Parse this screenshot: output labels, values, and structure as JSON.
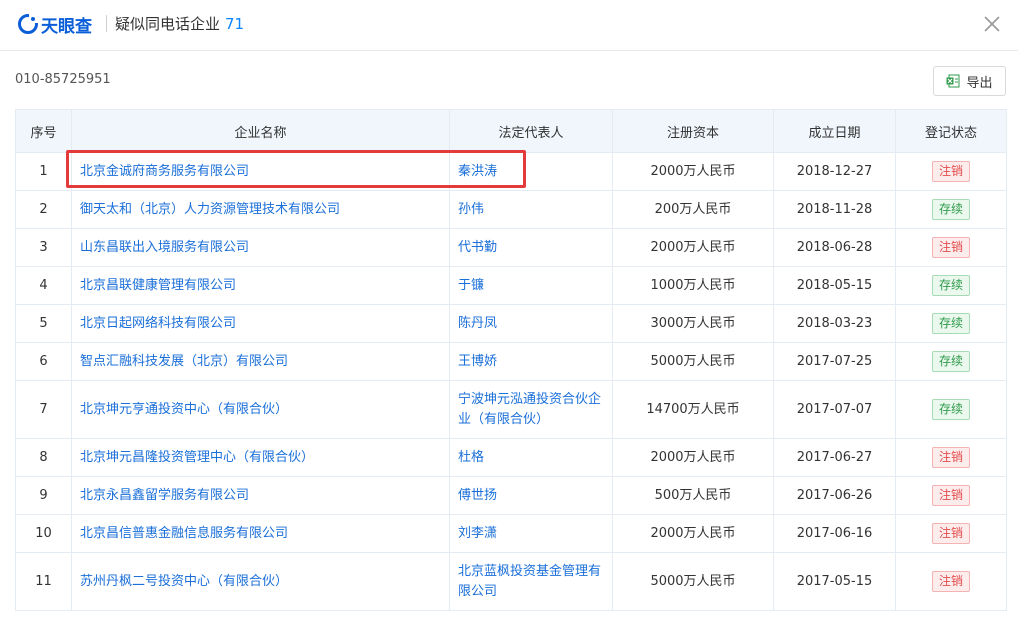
{
  "header": {
    "logo_text": "天眼查",
    "title": "疑似同电话企业",
    "count": "71"
  },
  "phone": "010-85725951",
  "export_label": "导出",
  "colors": {
    "link": "#1a6fd9",
    "accent": "#0a84ff",
    "cancel": "#e34c4c",
    "active": "#2e9b4b",
    "highlight": "#e33b3b"
  },
  "table": {
    "headers": [
      "序号",
      "企业名称",
      "法定代表人",
      "注册资本",
      "成立日期",
      "登记状态"
    ],
    "rows": [
      {
        "no": "1",
        "name": "北京金诚府商务服务有限公司",
        "rep": "秦洪涛",
        "capital": "2000万人民币",
        "date": "2018-12-27",
        "status": "注销",
        "status_type": "cancel"
      },
      {
        "no": "2",
        "name": "御天太和（北京）人力资源管理技术有限公司",
        "rep": "孙伟",
        "capital": "200万人民币",
        "date": "2018-11-28",
        "status": "存续",
        "status_type": "active"
      },
      {
        "no": "3",
        "name": "山东昌联出入境服务有限公司",
        "rep": "代书勤",
        "capital": "2000万人民币",
        "date": "2018-06-28",
        "status": "注销",
        "status_type": "cancel"
      },
      {
        "no": "4",
        "name": "北京昌联健康管理有限公司",
        "rep": "于镰",
        "capital": "1000万人民币",
        "date": "2018-05-15",
        "status": "存续",
        "status_type": "active"
      },
      {
        "no": "5",
        "name": "北京日起网络科技有限公司",
        "rep": "陈丹凤",
        "capital": "3000万人民币",
        "date": "2018-03-23",
        "status": "存续",
        "status_type": "active"
      },
      {
        "no": "6",
        "name": "智点汇融科技发展（北京）有限公司",
        "rep": "王博娇",
        "capital": "5000万人民币",
        "date": "2017-07-25",
        "status": "存续",
        "status_type": "active"
      },
      {
        "no": "7",
        "name": "北京坤元亨通投资中心（有限合伙）",
        "rep": "宁波坤元泓通投资合伙企业（有限合伙）",
        "capital": "14700万人民币",
        "date": "2017-07-07",
        "status": "存续",
        "status_type": "active"
      },
      {
        "no": "8",
        "name": "北京坤元昌隆投资管理中心（有限合伙）",
        "rep": "杜格",
        "capital": "2000万人民币",
        "date": "2017-06-27",
        "status": "注销",
        "status_type": "cancel"
      },
      {
        "no": "9",
        "name": "北京永昌鑫留学服务有限公司",
        "rep": "傅世扬",
        "capital": "500万人民币",
        "date": "2017-06-26",
        "status": "注销",
        "status_type": "cancel"
      },
      {
        "no": "10",
        "name": "北京昌信普惠金融信息服务有限公司",
        "rep": "刘李潇",
        "capital": "2000万人民币",
        "date": "2017-06-16",
        "status": "注销",
        "status_type": "cancel"
      },
      {
        "no": "11",
        "name": "苏州丹枫二号投资中心（有限合伙）",
        "rep": "北京蓝枫投资基金管理有限公司",
        "capital": "5000万人民币",
        "date": "2017-05-15",
        "status": "注销",
        "status_type": "cancel"
      }
    ]
  }
}
